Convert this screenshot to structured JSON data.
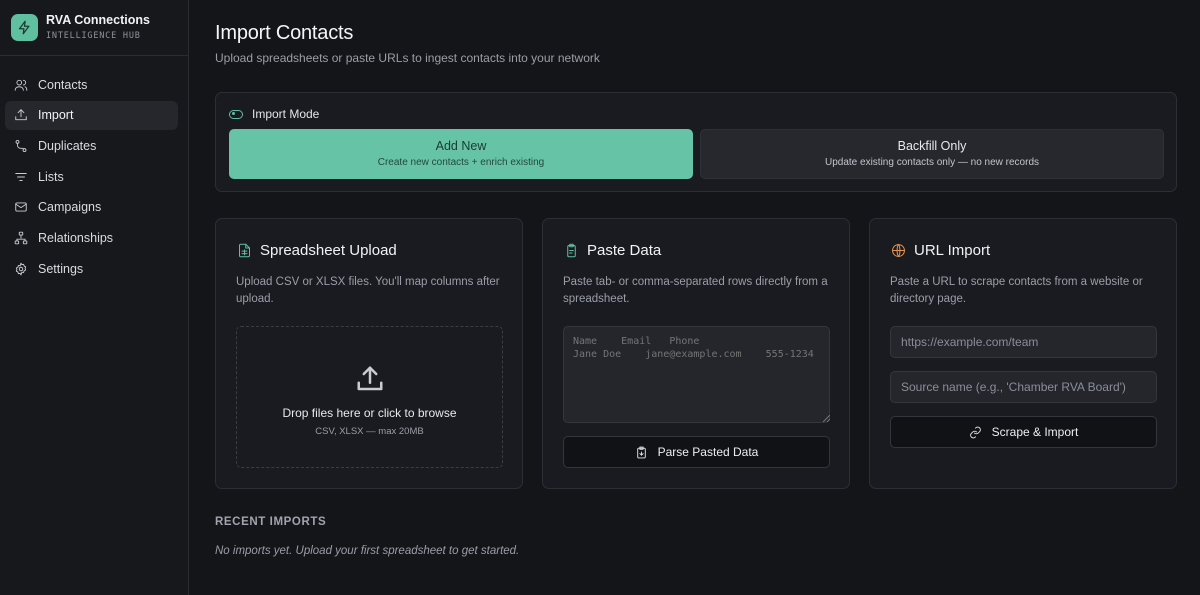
{
  "brand": {
    "name": "RVA Connections",
    "subtitle": "INTELLIGENCE HUB",
    "logo_icon": "bolt-icon",
    "accent": "#5fbf9f"
  },
  "sidebar": {
    "items": [
      {
        "label": "Contacts",
        "icon": "users-icon",
        "active": false
      },
      {
        "label": "Import",
        "icon": "upload-icon",
        "active": true
      },
      {
        "label": "Duplicates",
        "icon": "merge-icon",
        "active": false
      },
      {
        "label": "Lists",
        "icon": "filter-lines-icon",
        "active": false
      },
      {
        "label": "Campaigns",
        "icon": "mail-icon",
        "active": false
      },
      {
        "label": "Relationships",
        "icon": "network-icon",
        "active": false
      },
      {
        "label": "Settings",
        "icon": "gear-icon",
        "active": false
      }
    ]
  },
  "header": {
    "title": "Import Contacts",
    "subtitle": "Upload spreadsheets or paste URLs to ingest contacts into your network"
  },
  "import_mode": {
    "label": "Import Mode",
    "selected": "Add New",
    "options": [
      {
        "title": "Add New",
        "description": "Create new contacts + enrich existing"
      },
      {
        "title": "Backfill Only",
        "description": "Update existing contacts only — no new records"
      }
    ]
  },
  "spreadsheet": {
    "title": "Spreadsheet Upload",
    "description": "Upload CSV or XLSX files. You'll map columns after upload.",
    "drop_title": "Drop files here or click to browse",
    "drop_sub": "CSV, XLSX — max 20MB"
  },
  "paste": {
    "title": "Paste Data",
    "description": "Paste tab- or comma-separated rows directly from a spreadsheet.",
    "placeholder": "Name    Email   Phone\nJane Doe    jane@example.com    555-1234",
    "button_label": "Parse Pasted Data"
  },
  "url_import": {
    "title": "URL Import",
    "description": "Paste a URL to scrape contacts from a website or directory page.",
    "url_placeholder": "https://example.com/team",
    "source_placeholder": "Source name (e.g., 'Chamber RVA Board')",
    "button_label": "Scrape & Import"
  },
  "recent": {
    "title": "RECENT IMPORTS",
    "empty_text": "No imports yet. Upload your first spreadsheet to get started."
  }
}
